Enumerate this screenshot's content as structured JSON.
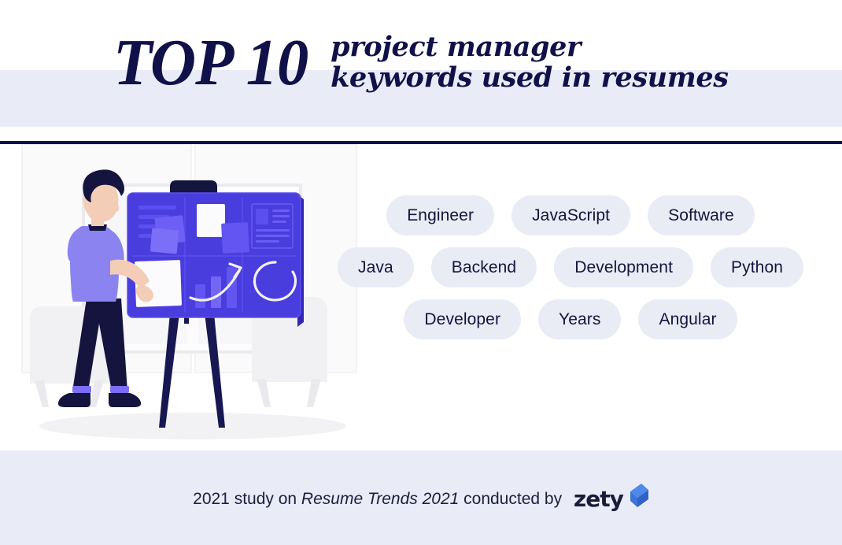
{
  "header": {
    "title_primary": "TOP 10",
    "title_secondary_line1": "project manager",
    "title_secondary_line2": "keywords used in resumes"
  },
  "keywords": {
    "rows": [
      {
        "items": [
          "Engineer",
          "JavaScript",
          "Software"
        ]
      },
      {
        "items": [
          "Java",
          "Backend",
          "Development",
          "Python"
        ]
      },
      {
        "items": [
          "Developer",
          "Years",
          "Angular"
        ]
      }
    ]
  },
  "footer": {
    "text_before": "2021 study on ",
    "source_italic": "Resume Trends 2021",
    "text_after": " conducted by ",
    "brand": "zety"
  },
  "illustration": {
    "alt": "man pinning notes to a presentation board on a tripod"
  },
  "colors": {
    "band": "#e9ecf7",
    "navy": "#11114a",
    "pill_bg": "#e9ecf5",
    "pill_text": "#14143c",
    "board_blue": "#4338ca",
    "shirt_purple": "#8b83f0",
    "brand_blue": "#3b6fe0"
  }
}
